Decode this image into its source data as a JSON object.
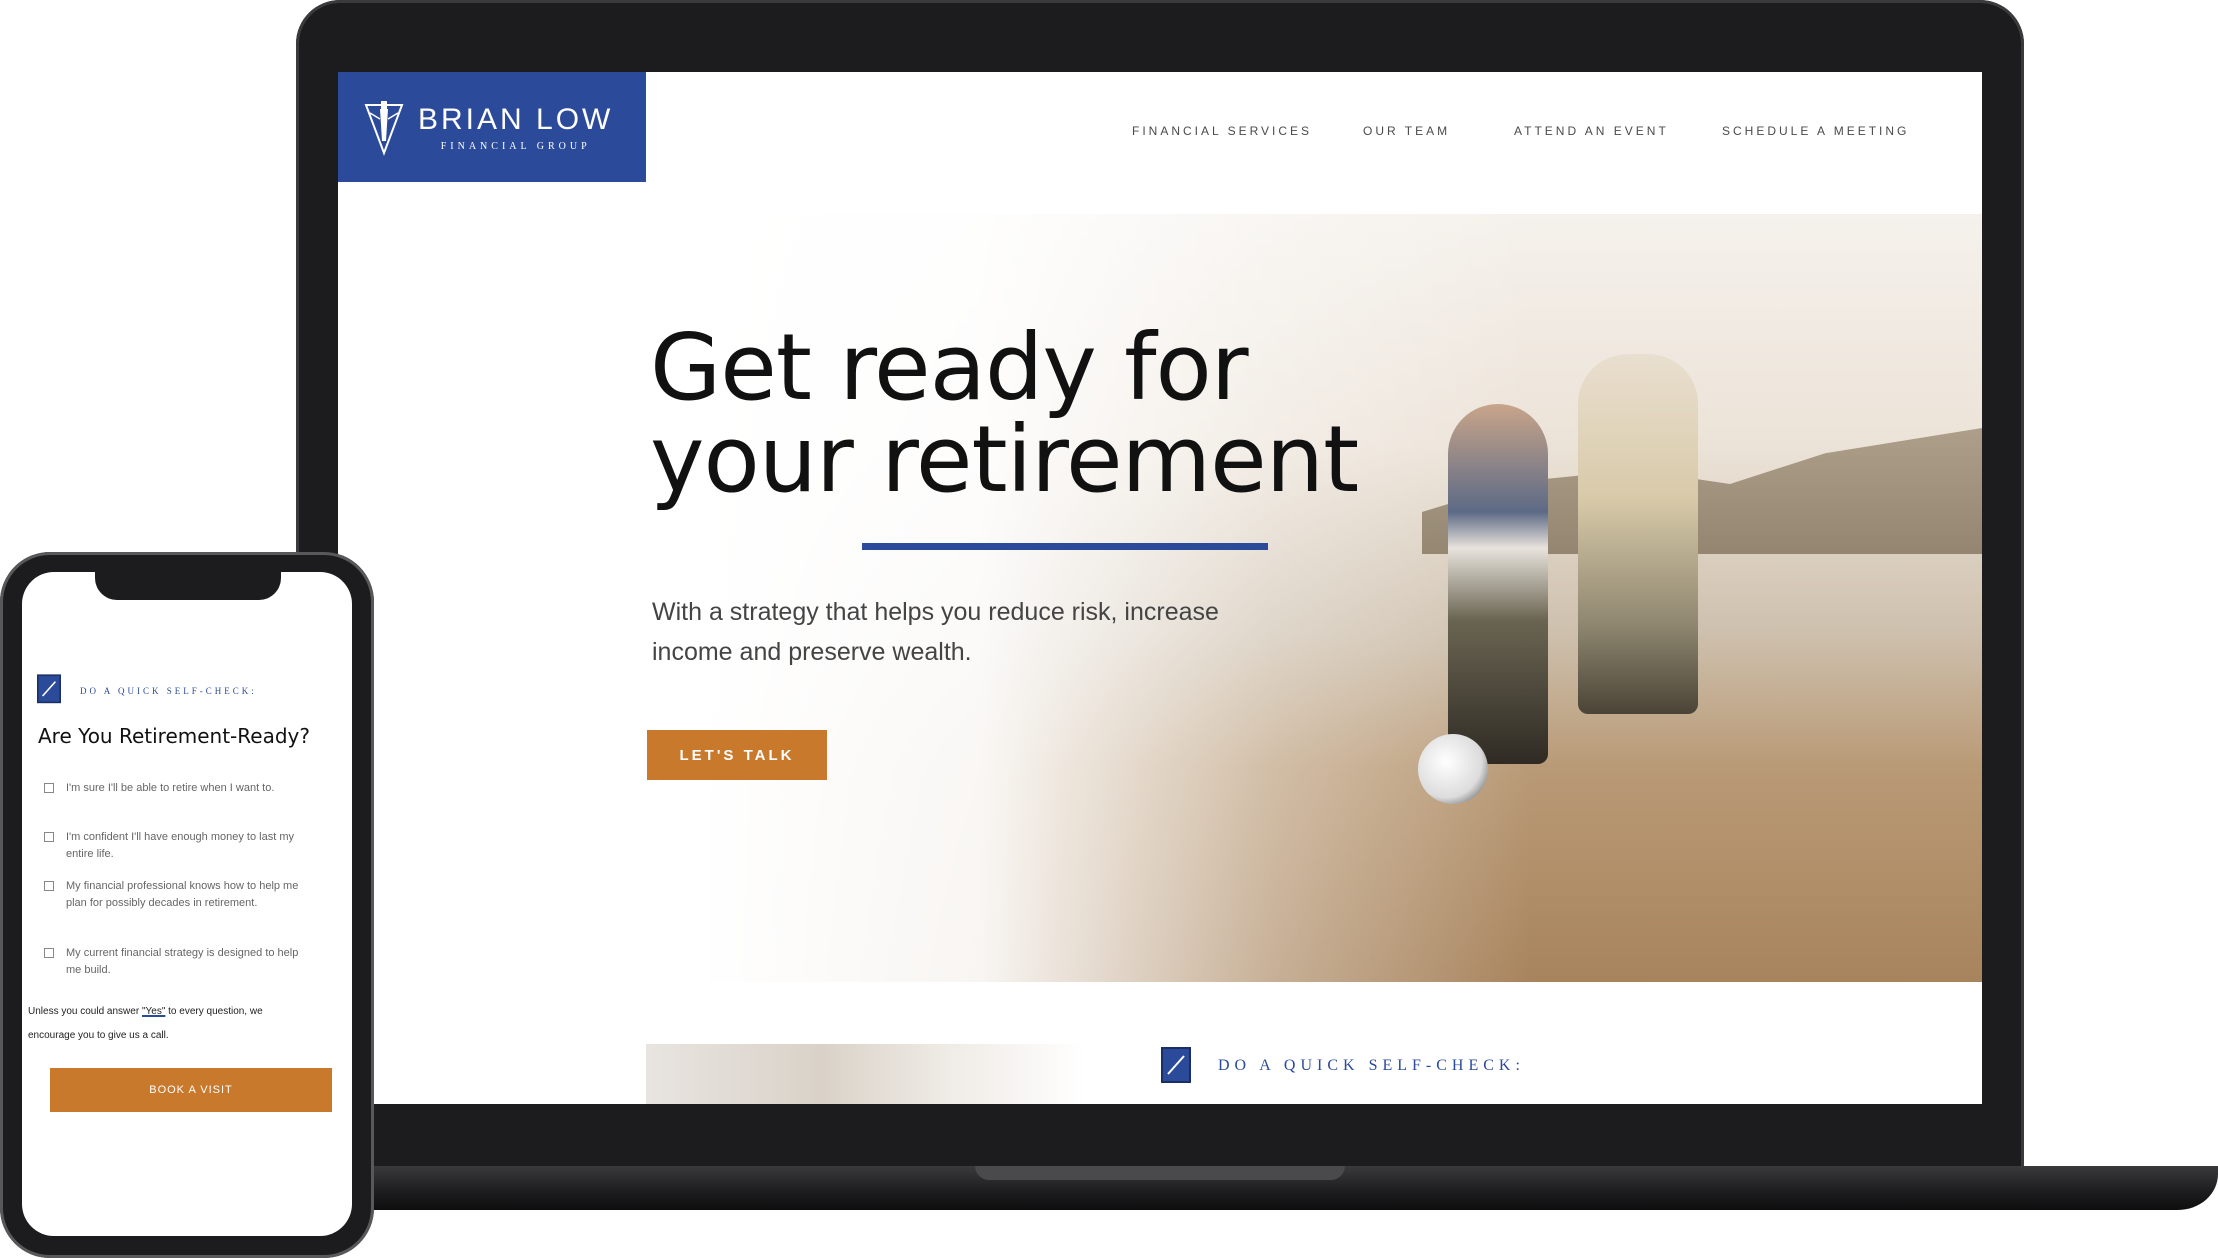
{
  "logo": {
    "name": "BRIAN LOW",
    "sub": "FINANCIAL GROUP"
  },
  "nav": [
    {
      "label": "FINANCIAL SERVICES"
    },
    {
      "label": "OUR TEAM"
    },
    {
      "label": "ATTEND AN EVENT"
    },
    {
      "label": "SCHEDULE A MEETING"
    }
  ],
  "hero": {
    "title_line1": "Get ready for",
    "title_line2a": "your ",
    "title_line2b": "retirement",
    "subtitle": "With a strategy that helps you reduce risk, increase income and preserve wealth.",
    "cta": "LET'S TALK"
  },
  "selfcheck": {
    "label": "DO A QUICK SELF-CHECK:"
  },
  "phone": {
    "eyebrow": "DO A QUICK SELF-CHECK:",
    "title": "Are You Retirement-Ready?",
    "checks": [
      "I'm sure I'll be able to retire when I want to.",
      "I'm confident I'll have enough money to last my entire life.",
      "My financial professional knows how to help me plan for possibly decades in retirement.",
      "My current financial strategy is designed to help me build."
    ],
    "note_pre": "Unless you could answer ",
    "note_yes": "\"Yes\"",
    "note_post": " to every question, we encourage you to give us a call.",
    "button": "BOOK A VISIT"
  },
  "colors": {
    "brand_blue": "#2c4a9a",
    "accent_orange": "#c9792c"
  }
}
